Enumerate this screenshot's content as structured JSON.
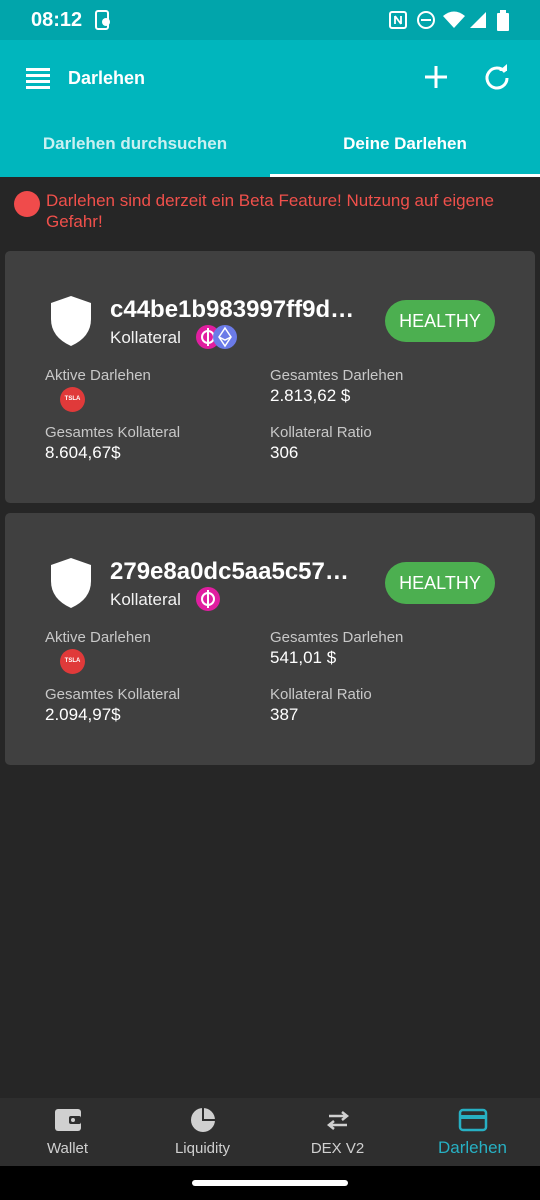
{
  "status_bar": {
    "time": "08:12"
  },
  "app_bar": {
    "title": "Darlehen"
  },
  "tabs": [
    {
      "label": "Darlehen durchsuchen",
      "active": false
    },
    {
      "label": "Deine Darlehen",
      "active": true
    }
  ],
  "warning": {
    "text": "Darlehen sind derzeit ein Beta Feature! Nutzung auf eigene Gefahr!"
  },
  "loans": [
    {
      "hash": "c44be1b983997ff9d…",
      "collateral_label": "Kollateral",
      "collateral_tokens": [
        "DFI",
        "ETH"
      ],
      "status": "HEALTHY",
      "active_loans_label": "Aktive Darlehen",
      "active_loans_token": "TSLA",
      "total_loan_label": "Gesamtes Darlehen",
      "total_loan_value": "2.813,62 $",
      "total_collateral_label": "Gesamtes Kollateral",
      "total_collateral_value": "8.604,67$",
      "ratio_label": "Kollateral Ratio",
      "ratio_value": "306"
    },
    {
      "hash": "279e8a0dc5aa5c57…",
      "collateral_label": "Kollateral",
      "collateral_tokens": [
        "DFI"
      ],
      "status": "HEALTHY",
      "active_loans_label": "Aktive Darlehen",
      "active_loans_token": "TSLA",
      "total_loan_label": "Gesamtes Darlehen",
      "total_loan_value": "541,01 $",
      "total_collateral_label": "Gesamtes Kollateral",
      "total_collateral_value": "2.094,97$",
      "ratio_label": "Kollateral Ratio",
      "ratio_value": "387"
    }
  ],
  "bottom_nav": [
    {
      "label": "Wallet",
      "icon": "wallet-icon",
      "active": false
    },
    {
      "label": "Liquidity",
      "icon": "pie-chart-icon",
      "active": false
    },
    {
      "label": "DEX V2",
      "icon": "swap-arrows-icon",
      "active": false
    },
    {
      "label": "Darlehen",
      "icon": "card-icon",
      "active": true
    }
  ],
  "colors": {
    "app_bar": "#00b6bd",
    "status_bar": "#01a5ab",
    "background": "#262626",
    "card": "#404040",
    "healthy_badge": "#4caf50",
    "warning": "#f04b4b",
    "active_nav": "#27b0c3",
    "dfi_token": "#e01ea0",
    "eth_token": "#6b7be8",
    "tsla_token": "#e03a3a"
  }
}
